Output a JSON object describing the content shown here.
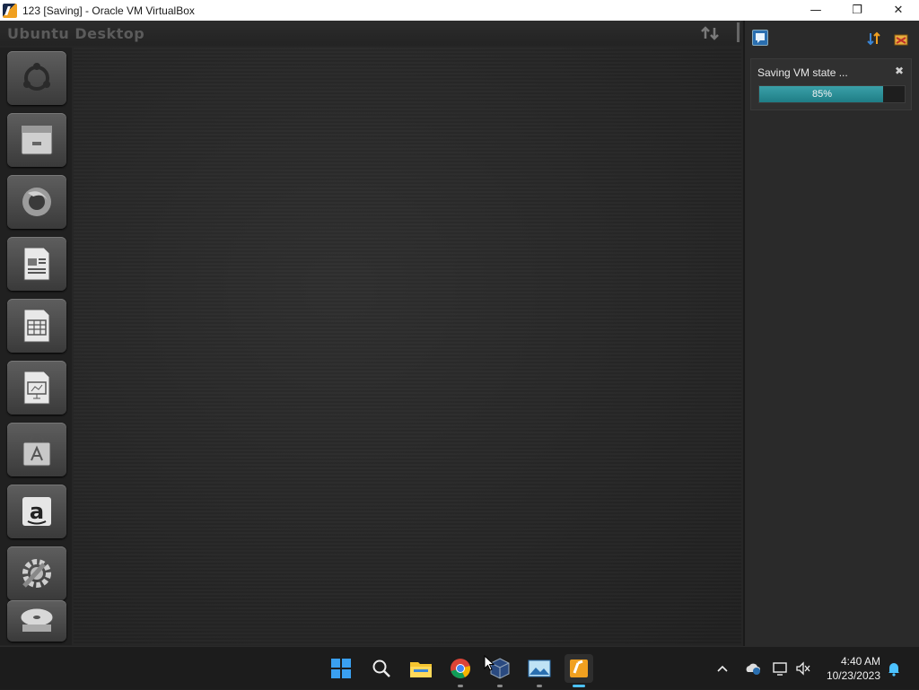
{
  "window": {
    "title": "123 [Saving] - Oracle VM VirtualBox",
    "minimize": "—",
    "maximize": "❐",
    "close": "✕"
  },
  "guest": {
    "topbar_title": "Ubuntu Desktop",
    "launcher_items": [
      "ubuntu-dash",
      "file-manager",
      "firefox",
      "libreoffice-writer",
      "libreoffice-calc",
      "libreoffice-impress",
      "ubuntu-software-center",
      "amazon",
      "system-settings",
      "disc-drive"
    ]
  },
  "notification": {
    "text": "Saving VM state ...",
    "close": "✖",
    "progress_label": "85%",
    "progress_value": 0.85
  },
  "taskbar": {
    "apps": [
      "start",
      "search",
      "file-explorer",
      "chrome",
      "virtualbox-manager",
      "photos",
      "virtualbox-vm"
    ],
    "clock_time": "4:40 AM",
    "clock_date": "10/23/2023",
    "tray_chevron": "^"
  },
  "colors": {
    "progress": "#2a8f98",
    "accent": "#4cc2ff"
  }
}
